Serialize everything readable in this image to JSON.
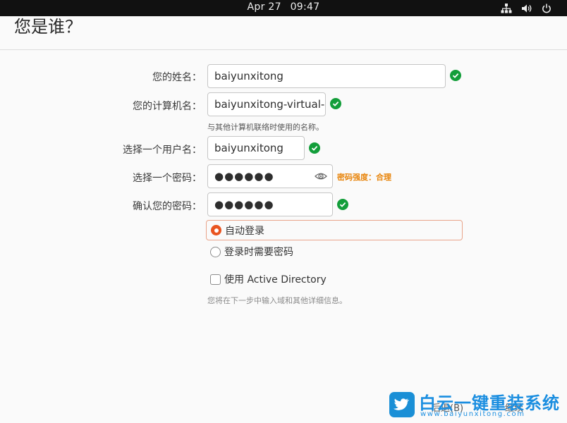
{
  "topbar": {
    "date": "Apr 27",
    "time": "09:47",
    "icons": [
      "network-icon",
      "volume-icon",
      "power-icon"
    ]
  },
  "page": {
    "title": "您是谁？"
  },
  "form": {
    "name": {
      "label": "您的姓名：",
      "value": "baiyunxitong",
      "valid": true
    },
    "computer": {
      "label": "您的计算机名：",
      "value": "baiyunxitong-virtual-m",
      "valid": true,
      "hint": "与其他计算机联络时使用的名称。"
    },
    "username": {
      "label": "选择一个用户名：",
      "value": "baiyunxitong",
      "valid": true
    },
    "password": {
      "label": "选择一个密码：",
      "value": "●●●●●●",
      "strength": "密码强度：合理"
    },
    "confirm": {
      "label": "确认您的密码：",
      "value": "●●●●●●",
      "valid": true
    }
  },
  "login_options": {
    "auto_login": {
      "label": "自动登录",
      "selected": true
    },
    "require_password": {
      "label": "登录时需要密码",
      "selected": false
    }
  },
  "active_directory": {
    "label": "使用 Active Directory",
    "checked": false,
    "hint": "您将在下一步中输入域和其他详细信息。"
  },
  "footer": {
    "back_label": "后退(B)",
    "continue_label": "继续"
  },
  "watermark": {
    "title": "白云一键重装系统",
    "url": "www.baiyunxitong.com"
  },
  "colors": {
    "accent": "#e95420",
    "valid": "#139e3a",
    "strength": "#e8850c",
    "topbar": "#111111",
    "watermark": "#1b8ee0"
  }
}
